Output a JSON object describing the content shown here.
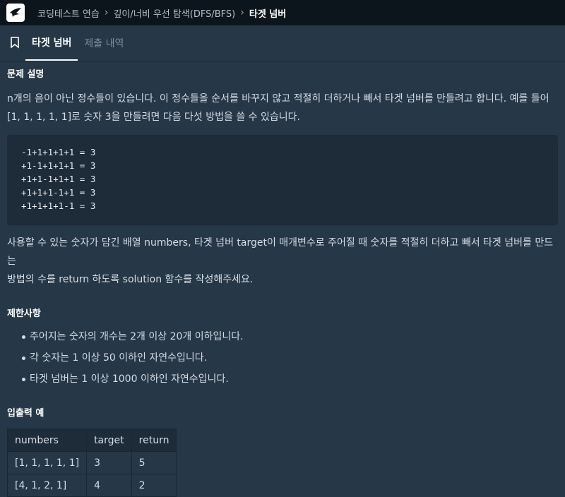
{
  "breadcrumb": {
    "items": [
      "코딩테스트 연습",
      "깊이/너비 우선 탐색(DFS/BFS)"
    ],
    "current": "타겟 넘버"
  },
  "tabs": [
    "타겟 넘버",
    "제출 내역"
  ],
  "sections": {
    "description_title": "문제 설명",
    "desc_p1_line1": "n개의 음이 아닌 정수들이 있습니다. 이 정수들을 순서를 바꾸지 않고 적절히 더하거나 빼서 타겟 넘버를 만들려고 합니다. 예를 들어",
    "desc_p1_line2": "[1, 1, 1, 1, 1]로 숫자 3을 만들려면 다음 다섯 방법을 쓸 수 있습니다.",
    "code_lines": [
      "-1+1+1+1+1 = 3",
      "+1-1+1+1+1 = 3",
      "+1+1-1+1+1 = 3",
      "+1+1+1-1+1 = 3",
      "+1+1+1+1-1 = 3"
    ],
    "desc_p2_line1": "사용할 수 있는 숫자가 담긴 배열 numbers, 타겟 넘버 target이 매개변수로 주어질 때 숫자를 적절히 더하고 빼서 타겟 넘버를 만드는",
    "desc_p2_line2": "방법의 수를 return 하도록 solution 함수를 작성해주세요.",
    "constraints_title": "제한사항",
    "constraints": [
      "주어지는 숫자의 개수는 2개 이상 20개 이하입니다.",
      "각 숫자는 1 이상 50 이하인 자연수입니다.",
      "타겟 넘버는 1 이상 1000 이하인 자연수입니다."
    ],
    "examples_title": "입출력 예",
    "table": {
      "headers": [
        "numbers",
        "target",
        "return"
      ],
      "rows": [
        [
          "[1, 1, 1, 1, 1]",
          "3",
          "5"
        ],
        [
          "[4, 1, 2, 1]",
          "4",
          "2"
        ]
      ]
    }
  }
}
